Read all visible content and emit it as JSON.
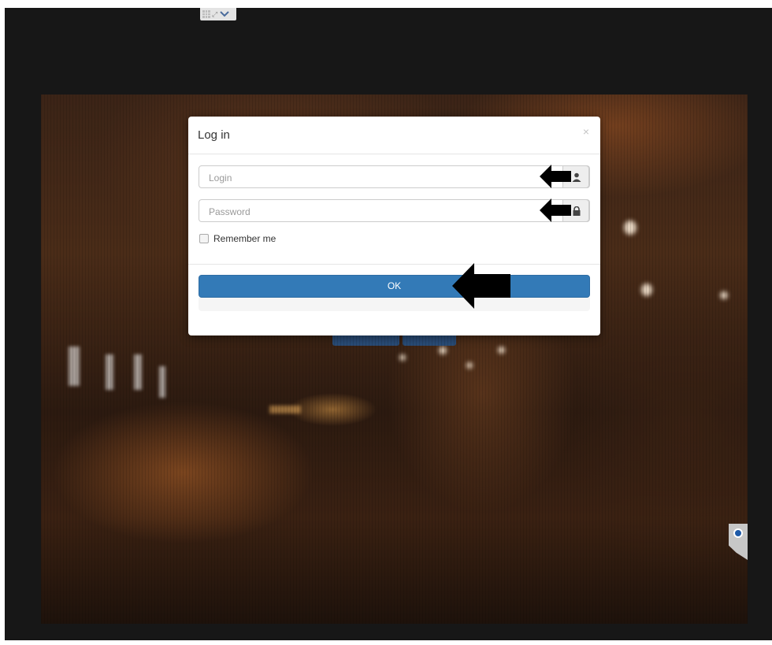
{
  "modal": {
    "title": "Log in",
    "close_symbol": "×",
    "login": {
      "placeholder": "Login",
      "value": ""
    },
    "password": {
      "placeholder": "Password",
      "value": ""
    },
    "remember_label": "Remember me",
    "remember_checked": false,
    "ok_label": "OK"
  },
  "icons": {
    "toolbar": [
      "grid-icon",
      "expand-icon",
      "chevron-down-icon"
    ],
    "login_addon": "user-icon",
    "password_addon": "lock-icon",
    "side_tab": "teamviewer-icon",
    "annotations": [
      "arrow-left-icon",
      "arrow-left-icon",
      "arrow-left-icon"
    ]
  },
  "colors": {
    "primary_button": "#337ab7",
    "outer_background": "#171717",
    "annotation_arrow": "#000000"
  }
}
